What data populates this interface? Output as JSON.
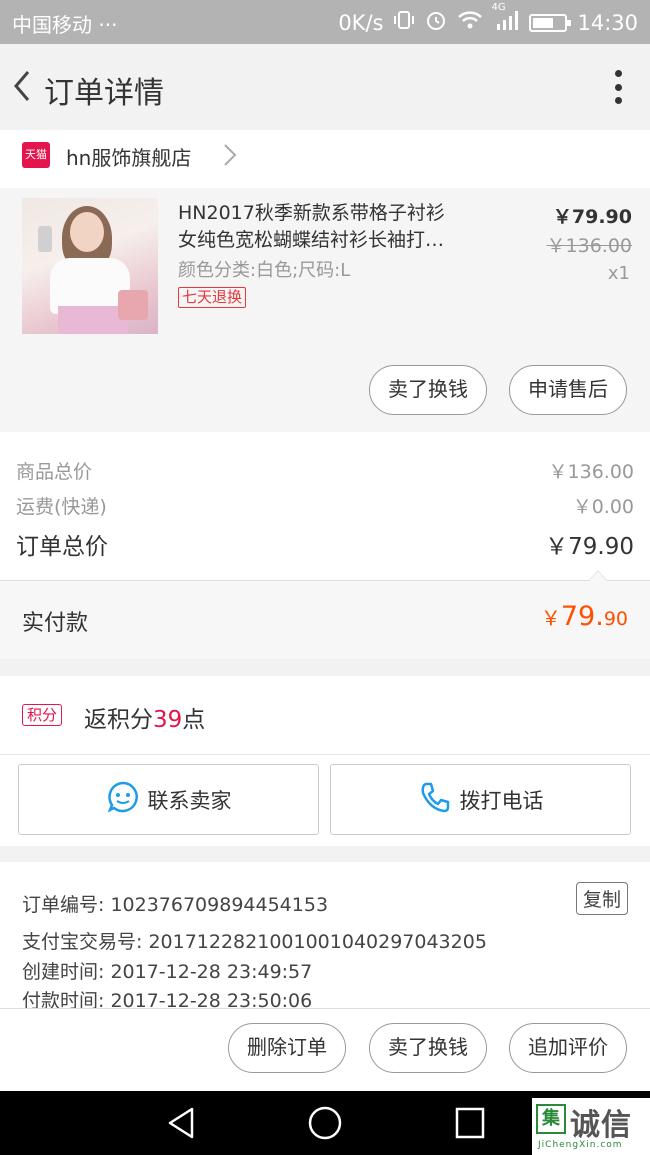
{
  "status_bar": {
    "carrier": "中国移动",
    "dots": "···",
    "speed": "0K/s",
    "network": "4G",
    "time": "14:30",
    "battery_level": 0.65
  },
  "header": {
    "title": "订单详情",
    "back_icon": "chevron-left-icon",
    "more_icon": "more-vertical-icon"
  },
  "store": {
    "badge": "天猫",
    "name": "hn服饰旗舰店"
  },
  "product": {
    "title_line1": "HN2017秋季新款系带格子衬衫",
    "title_line2": "女纯色宽松蝴蝶结衬衫长袖打…",
    "sku": "颜色分类:白色;尺码:L",
    "badge": "七天退换",
    "price": "￥79.90",
    "original_price": "￥136.00",
    "quantity": "x1",
    "sell_button": "卖了换钱",
    "after_sale_button": "申请售后"
  },
  "summary": {
    "goods_total_label": "商品总价",
    "goods_total_value": "￥136.00",
    "shipping_label": "运费(快递)",
    "shipping_value": "￥0.00",
    "order_total_label": "订单总价",
    "order_total_value": "￥79.90"
  },
  "paid": {
    "label": "实付款",
    "currency": "￥",
    "amount_int": "79.",
    "amount_dec": "90"
  },
  "points": {
    "tag": "积分",
    "prefix": "返积分",
    "value": "39",
    "suffix": "点"
  },
  "contact": {
    "seller_label": "联系卖家",
    "call_label": "拨打电话"
  },
  "order_info": {
    "order_no": "订单编号: 102376709894454153",
    "copy_label": "复制",
    "alipay_no": "支付宝交易号: 2017122821001001040297043205",
    "created": "创建时间: 2017-12-28 23:49:57",
    "paid_time": "付款时间: 2017-12-28 23:50:06"
  },
  "bottom_actions": {
    "delete": "删除订单",
    "sell": "卖了换钱",
    "review": "追加评价"
  },
  "watermark": {
    "logo_char": "集",
    "text": "诚信",
    "sub": "JiChengXin.com"
  },
  "colors": {
    "accent_orange": "#ff5000",
    "tmall_red": "#e4144c",
    "link_blue": "#1e9be9"
  }
}
